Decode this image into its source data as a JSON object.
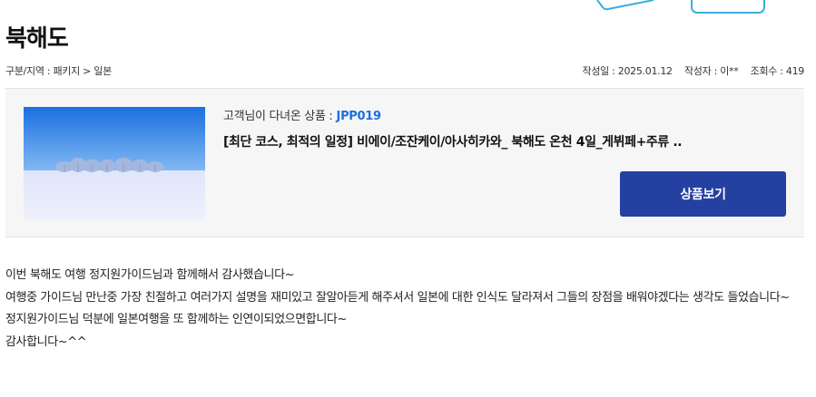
{
  "post": {
    "title": "북해도",
    "category": "구분/지역 : 패키지 > 일본",
    "created": "작성일 : 2025.01.12",
    "author": "작성자 : 이**",
    "views": "조회수 : 419"
  },
  "product": {
    "visited_label": "고객님이 다녀온 상품 :",
    "code": "JPP019",
    "name": "[최단 코스, 최적의 일정] 비에이/조잔케이/아사히카와_ 북해도 온천 4일_게뷔페+주류 ..",
    "view_button": "상품보기"
  },
  "content": {
    "lines": [
      "이번 북해도 여행 정지원가이드님과 함께해서 감사했습니다~",
      "여행중  가이드님 만난중 가장 친절하고 여러가지 설명을 재미있고 잘알아듣게 해주셔서  일본에 대한 인식도 달라져서  그들의 장점을 배워야겠다는 생각도 들었습니다~",
      "정지원가이드님 덕분에 일본여행을  또  함께하는 인연이되었으면합니다~",
      "감사합니다~^^"
    ]
  },
  "colors": {
    "accent": "#2440a0",
    "code": "#1e6fe0",
    "box_bg": "#f6f6f6"
  },
  "icons": {
    "decoration": "computer-illustration-icon",
    "thumbnail": "snowy-field-trees-image"
  }
}
